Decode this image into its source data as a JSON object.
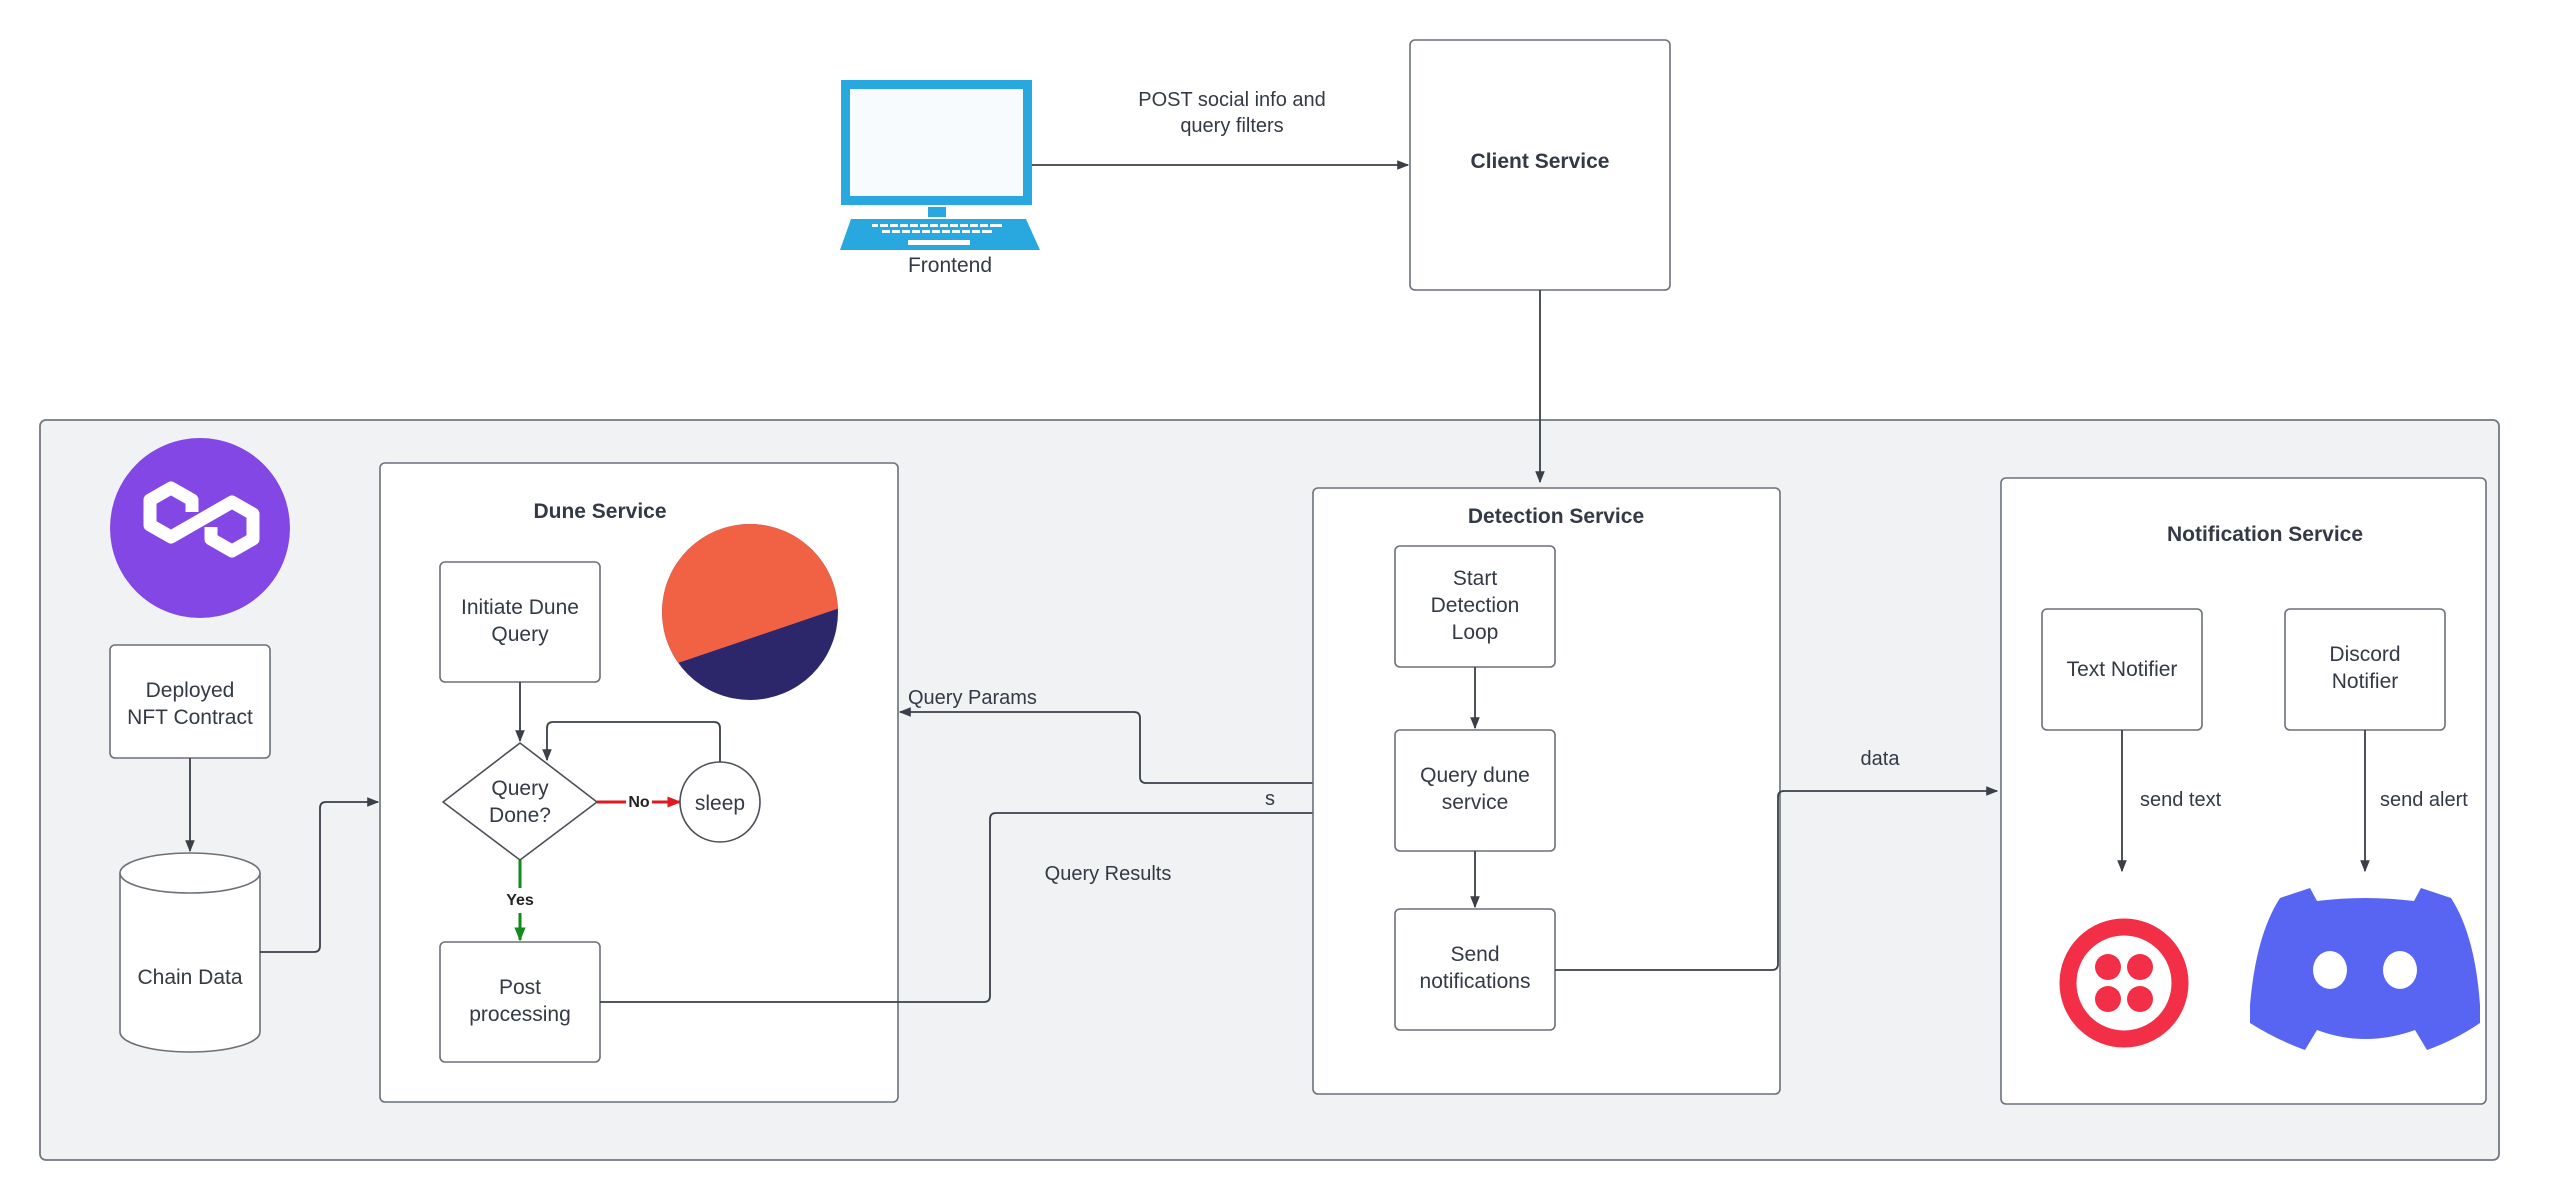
{
  "colors": {
    "laptop": "#29a8e0",
    "polygon": "#8247e5",
    "dune_orange": "#f06243",
    "dune_navy": "#2c276a",
    "twilio": "#f22f46",
    "discord": "#5865f2",
    "no_edge": "#e0191e",
    "yes_edge": "#138a1c"
  },
  "frontend": {
    "label": "Frontend",
    "icon": "laptop-icon"
  },
  "client_service": {
    "title": "Client Service"
  },
  "edges": {
    "frontend_to_client": {
      "line1": "POST  social info and",
      "line2": "query filters"
    },
    "query_params": "Query Params",
    "s_label": "s",
    "query_results": "Query Results",
    "data": "data",
    "send_text": "send text",
    "send_alert": "send alert",
    "no": "No",
    "yes": "Yes"
  },
  "chain": {
    "logo": "polygon-logo-icon",
    "deployed": {
      "line1": "Deployed",
      "line2": "NFT Contract"
    },
    "chain_data": "Chain Data"
  },
  "dune_service": {
    "title": "Dune Service",
    "logo": "dune-logo-icon",
    "initiate": {
      "line1": "Initiate Dune",
      "line2": "Query"
    },
    "decision": {
      "line1": "Query",
      "line2": "Done?"
    },
    "sleep": "sleep",
    "post": {
      "line1": "Post",
      "line2": "processing"
    }
  },
  "detection_service": {
    "title": "Detection Service",
    "start": {
      "line1": "Start",
      "line2": "Detection",
      "line3": "Loop"
    },
    "query": {
      "line1": "Query dune",
      "line2": "service"
    },
    "send": {
      "line1": "Send",
      "line2": "notifications"
    }
  },
  "notification_service": {
    "title": "Notification Service",
    "text_notifier": "Text Notifier",
    "discord_notifier": {
      "line1": "Discord",
      "line2": "Notifier"
    },
    "twilio_icon": "twilio-logo-icon",
    "discord_icon": "discord-logo-icon"
  }
}
